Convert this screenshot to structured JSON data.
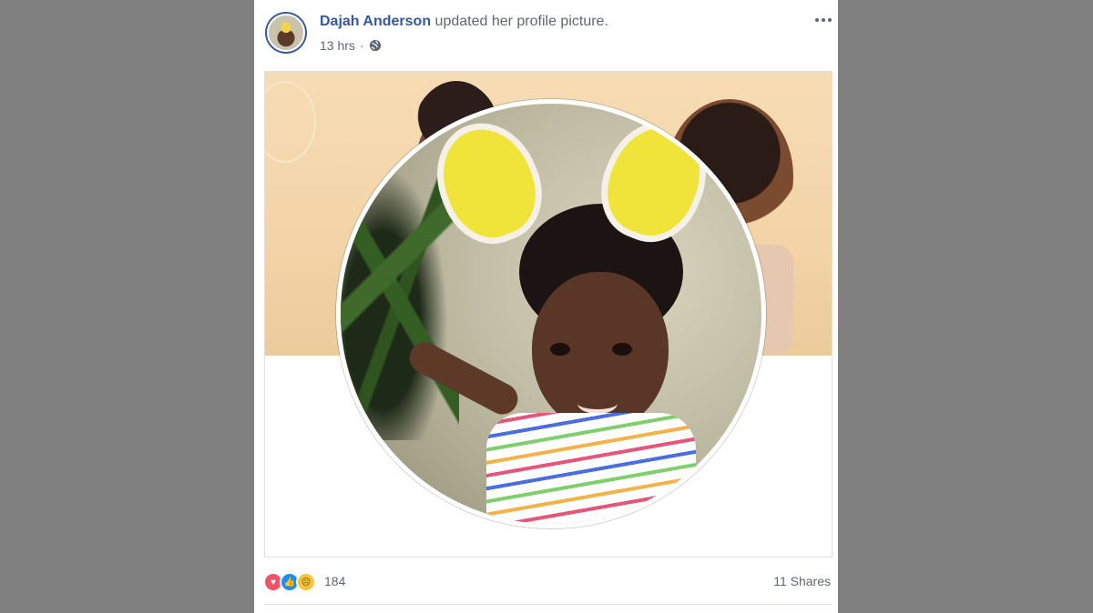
{
  "post": {
    "author": "Dajah Anderson",
    "action": "updated her profile picture.",
    "time": "13 hrs",
    "privacy_separator": "·",
    "privacy_icon": "globe-icon",
    "more_icon": "more-options-icon"
  },
  "photo": {
    "description_icon": "profile-photo"
  },
  "footer": {
    "reactions": [
      "love-reaction-icon",
      "like-reaction-icon",
      "sad-reaction-icon"
    ],
    "reaction_count": "184",
    "shares": "11 Shares"
  },
  "colors": {
    "author": "#365899",
    "page_bg": "#808080",
    "love": "#f25268",
    "like": "#1d8df0",
    "sad": "#f7c33d"
  }
}
